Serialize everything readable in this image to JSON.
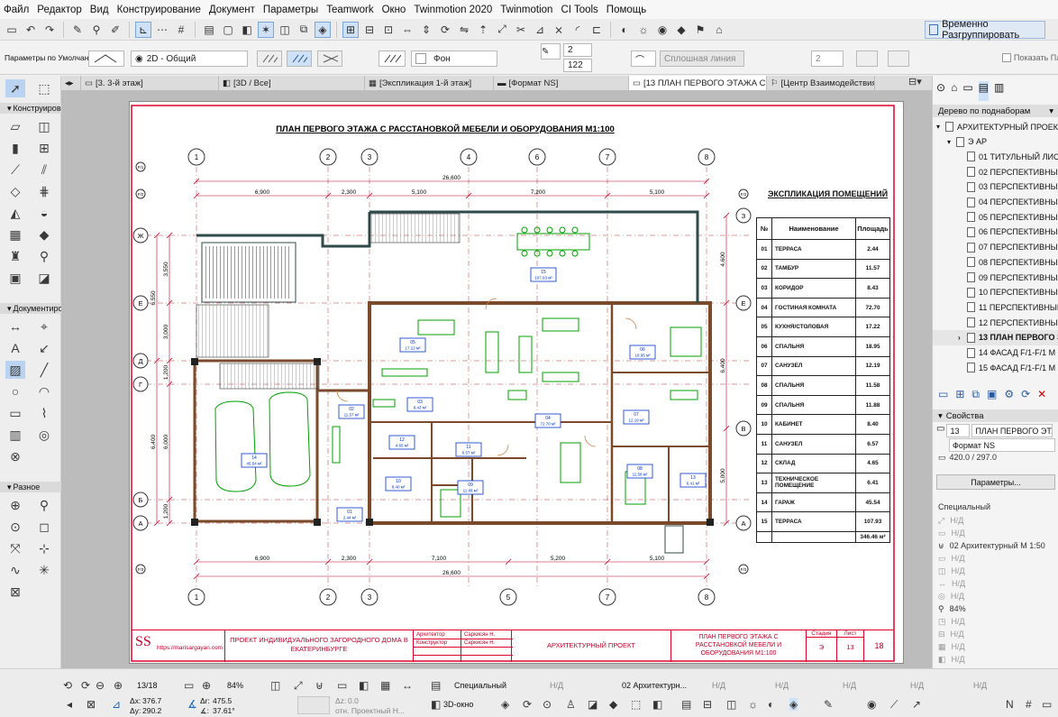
{
  "menu": [
    "Файл",
    "Редактор",
    "Вид",
    "Конструирование",
    "Документ",
    "Параметры",
    "Teamwork",
    "Окно",
    "Twinmotion 2020",
    "Twinmotion",
    "CI Tools",
    "Помощь"
  ],
  "toolbar": {
    "regroup_label": "Временно Разгруппировать"
  },
  "infobox": {
    "preset": "Параметры по Умолчанию",
    "view_mode": "2D - Общий",
    "background": "Фон",
    "pen1": "2",
    "pen2": "122",
    "line_type": "Сплошная линия",
    "num": "2",
    "show_label": "Показать План"
  },
  "tabs": [
    "[3. 3-й этаж]",
    "[3D / Все]",
    "[Экспликация 1-й этаж]",
    "[Формат NS]",
    "[13 ПЛАН ПЕРВОГО ЭТАЖА С Р...",
    "[Центр Взаимодействия]"
  ],
  "left_panel": {
    "sec1": "Конструирова",
    "sec2": "Документиро",
    "sec3": "Разное"
  },
  "sheet": {
    "title": "ПЛАН ПЕРВОГО ЭТАЖА С РАССТАНОВКОЙ МЕБЕЛИ И ОБОРУДОВАНИЯ М1:100",
    "axes_top": [
      "1",
      "2",
      "3",
      "4",
      "6",
      "7",
      "8"
    ],
    "axes_bottom": [
      "1",
      "2",
      "3",
      "5",
      "7",
      "8"
    ],
    "axes_left": [
      "Ж",
      "Е",
      "Д",
      "Г",
      "Б",
      "А"
    ],
    "axes_right": [
      "З",
      "Е",
      "В",
      "А"
    ],
    "dims_top": [
      "6,900",
      "2,300",
      "5,100",
      "7,200",
      "5,100"
    ],
    "dims_bottom": [
      "6,900",
      "2,300",
      "7,100",
      "5,200",
      "5,100"
    ],
    "total_dim": "26,600",
    "dims_left_outer": [
      "6,550",
      "6,400"
    ],
    "dims_left_inner": [
      "3,550",
      "3,000",
      "1,200",
      "6,000",
      "1,200"
    ],
    "dims_right": [
      "4,600",
      "6,400",
      "5,000"
    ],
    "level_marks": [
      "F/1",
      "F/2",
      "F/3"
    ],
    "room_tags": [
      {
        "n": "15",
        "a": "107.93 м²"
      },
      {
        "n": "05",
        "a": "17.22 м²"
      },
      {
        "n": "06",
        "a": "18.95 м²"
      },
      {
        "n": "03",
        "a": "8.43 м²"
      },
      {
        "n": "02",
        "a": "11.57 м²"
      },
      {
        "n": "04",
        "a": "72.70 м²"
      },
      {
        "n": "07",
        "a": "12.19 м²"
      },
      {
        "n": "12",
        "a": "4.65 м²"
      },
      {
        "n": "11",
        "a": "6.57 м²"
      },
      {
        "n": "14",
        "a": "45.54 м²"
      },
      {
        "n": "10",
        "a": "8.40 м²"
      },
      {
        "n": "09",
        "a": "11.88 м²"
      },
      {
        "n": "08",
        "a": "11.58 м²"
      },
      {
        "n": "13",
        "a": "6.41 м²"
      },
      {
        "n": "01",
        "a": "2.44 м²"
      }
    ],
    "explication": {
      "title": "ЭКСПЛИКАЦИЯ ПОМЕЩЕНИЙ",
      "headers": [
        "№",
        "Наименование",
        "Площадь"
      ],
      "rows": [
        [
          "01",
          "ТЕРРАСА",
          "2.44"
        ],
        [
          "02",
          "ТАМБУР",
          "11.57"
        ],
        [
          "03",
          "КОРИДОР",
          "8.43"
        ],
        [
          "04",
          "ГОСТИНАЯ КОМНАТА",
          "72.70"
        ],
        [
          "05",
          "КУХНЯ/СТОЛОВАЯ",
          "17.22"
        ],
        [
          "06",
          "СПАЛЬНЯ",
          "18.95"
        ],
        [
          "07",
          "САНУЗЕЛ",
          "12.19"
        ],
        [
          "08",
          "СПАЛЬНЯ",
          "11.58"
        ],
        [
          "09",
          "СПАЛЬНЯ",
          "11.88"
        ],
        [
          "10",
          "КАБИНЕТ",
          "8.40"
        ],
        [
          "11",
          "САНУЗЕЛ",
          "6.57"
        ],
        [
          "12",
          "СКЛАД",
          "4.65"
        ],
        [
          "13",
          "ТЕХНИЧЕСКОЕ ПОМЕЩЕНИЕ",
          "6.41"
        ],
        [
          "14",
          "ГАРАЖ",
          "45.54"
        ],
        [
          "15",
          "ТЕРРАСА",
          "107.93"
        ]
      ],
      "total": "346.46 м²"
    },
    "stamp": {
      "logo_url": "https://marisargayan.com",
      "project": "ПРОЕКТ ИНДИВИДУАЛЬНОГО ЗАГОРОДНОГО ДОМА В ЕКАТЕРИНБУРГЕ",
      "role1": "Архитектор",
      "name1": "Саркисян Н.",
      "role2": "Конструктор",
      "name2": "Саркисян Н.",
      "section": "АРХИТЕКТУРНЫЙ ПРОЕКТ",
      "sheet_title": "ПЛАН ПЕРВОГО ЭТАЖА С РАССТАНОВКОЙ МЕБЕЛИ И ОБОРУДОВАНИЯ М1:100",
      "stage_h": "Стадия",
      "stage": "Э",
      "sheet_h": "Лист",
      "sheet_no": "13",
      "total_sheets": "18"
    }
  },
  "navigator": {
    "header": "Дерево по поднаборам",
    "items": [
      {
        "label": "АРХИТЕКТУРНЫЙ ПРОЕКТ",
        "level": 0
      },
      {
        "label": "Э АР",
        "level": 1
      },
      {
        "label": "01 ТИТУЛЬНЫЙ ЛИСТ",
        "level": 2
      },
      {
        "label": "02 ПЕРСПЕКТИВНЫЙ",
        "level": 2
      },
      {
        "label": "03 ПЕРСПЕКТИВНЫЙ",
        "level": 2
      },
      {
        "label": "04 ПЕРСПЕКТИВНЫЙ",
        "level": 2
      },
      {
        "label": "05 ПЕРСПЕКТИВНЫЙ",
        "level": 2
      },
      {
        "label": "06 ПЕРСПЕКТИВНЫЙ",
        "level": 2
      },
      {
        "label": "07 ПЕРСПЕКТИВНЫЙ",
        "level": 2
      },
      {
        "label": "08 ПЕРСПЕКТИВНЫЙ",
        "level": 2
      },
      {
        "label": "09 ПЕРСПЕКТИВНЫЙ",
        "level": 2
      },
      {
        "label": "10 ПЕРСПЕКТИВНЫЙ",
        "level": 2
      },
      {
        "label": "11 ПЕРСПЕКТИВНЫЙ",
        "level": 2
      },
      {
        "label": "12 ПЕРСПЕКТИВНЫЙ",
        "level": 2
      },
      {
        "label": "13 ПЛАН ПЕРВОГО Э",
        "level": 2,
        "selected": true
      },
      {
        "label": "14 ФАСАД  F/1-F/1  М",
        "level": 2
      },
      {
        "label": "15 ФАСАД  F/1-F/1  М",
        "level": 2
      }
    ]
  },
  "properties": {
    "header": "Свойства",
    "id": "13",
    "name": "ПЛАН ПЕРВОГО ЭТАЖА",
    "format": "Формат NS",
    "size": "420.0 / 297.0",
    "params_btn": "Параметры...",
    "special": "Специальный",
    "nd": "Н/Д",
    "layer": "02 Архитектурный М 1:50",
    "zoom": "84%"
  },
  "status": {
    "page": "13/18",
    "zoom": "84%",
    "special": "Специальный",
    "nd": "Н/Д",
    "layer": "02 Архитектурн...",
    "dx_label": "Δx:",
    "dx": "376.7",
    "dy_label": "Δy:",
    "dy": "290.2",
    "dr_label": "Δr:",
    "dr": "475.5",
    "da_label": "∡:",
    "da": "37.61°",
    "dz_label": "Δz:",
    "dz": "0.0",
    "ref": "отн. Проектный Н...",
    "view3d": "3D-окно"
  },
  "colors": {
    "accent": "#1565c0",
    "sheet_red": "#e0002a",
    "plan_green": "#00a000",
    "wall": "#7b4a2a"
  }
}
